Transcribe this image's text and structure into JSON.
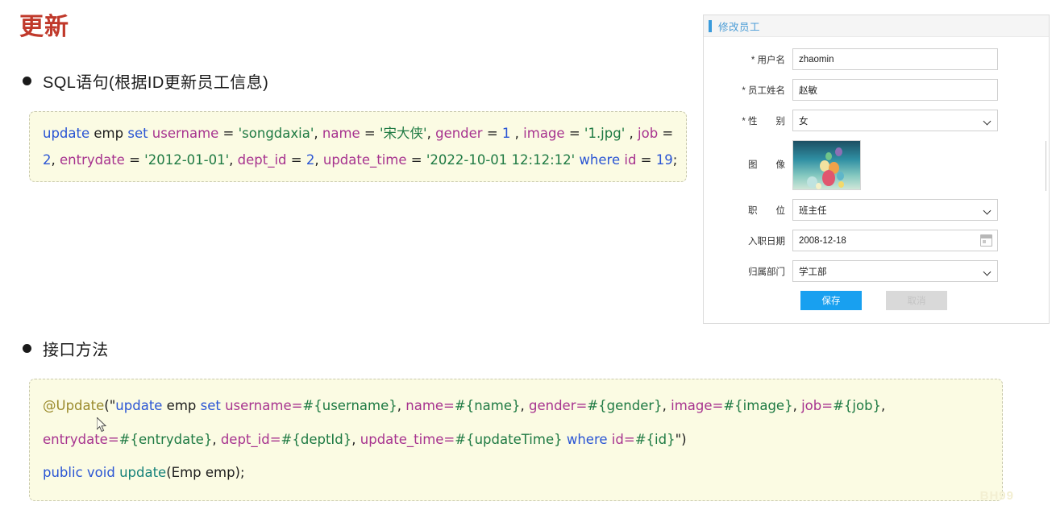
{
  "slide": {
    "title": "更新",
    "bullets": [
      {
        "id": "sql",
        "text": "SQL语句(根据ID更新员工信息)"
      },
      {
        "id": "api",
        "text": "接口方法"
      }
    ],
    "watermark": "BH99"
  },
  "sql_code": {
    "line1": {
      "kw_update": "update",
      "tbl": " emp ",
      "kw_set": "set",
      "col_username": " username",
      "eq1": " = ",
      "str_username": "'songdaxia'",
      "comma1": ", ",
      "col_name": "name",
      "eq2": " = ",
      "str_name": "'宋大侠'",
      "comma2": ", ",
      "col_gender": "gender",
      "eq3": " = ",
      "num_gender": "1",
      "comma3": " , ",
      "col_image": "image",
      "eq4": " = ",
      "str_image": "'1.jpg'",
      "comma4": " , ",
      "col_job": "job",
      "eq5": " ="
    },
    "line2": {
      "num_job": "2",
      "comma1": ", ",
      "col_entrydate": "entrydate",
      "eq1": " = ",
      "str_entrydate": "'2012-01-01'",
      "comma2": ", ",
      "col_deptid": "dept_id",
      "eq2": " = ",
      "num_deptid": "2",
      "comma3": ", ",
      "col_updatetime": "update_time",
      "eq3": " = ",
      "str_updatetime": "'2022-10-01 12:12:12'",
      "sp": " ",
      "kw_where": "where",
      "col_id": " id",
      "eq4": " = ",
      "num_id": "19",
      "semi": ";"
    }
  },
  "api_code": {
    "line1": {
      "annotation": "@Update",
      "open": "(\"",
      "kw_update": "update",
      "tbl": " emp ",
      "kw_set": "set",
      "col_username": " username=",
      "p_username": "#{username}",
      "c1": ", ",
      "col_name": "name=",
      "p_name": "#{name}",
      "c2": ", ",
      "col_gender": "gender=",
      "p_gender": "#{gender}",
      "c3": ", ",
      "col_image": "image=",
      "p_image": "#{image}",
      "c4": ", ",
      "col_job": "job=",
      "p_job": "#{job}",
      "c5": ","
    },
    "line2": {
      "col_entrydate": "entrydate=",
      "p_entrydate": "#{entrydate}",
      "c1": ", ",
      "col_deptid": "dept_id=",
      "p_deptid": "#{deptId}",
      "c2": ", ",
      "col_updatetime": "update_time=",
      "p_updatetime": "#{updateTime}",
      "sp": " ",
      "kw_where": "where",
      "col_id": " id=",
      "p_id": "#{id}",
      "close": "\")"
    },
    "line3": {
      "modifiers": "public void ",
      "method": "update",
      "signature": "(Emp emp);"
    }
  },
  "form": {
    "title": "修改员工",
    "fields": [
      {
        "label": "* 用户名",
        "value": "zhaomin",
        "type": "text"
      },
      {
        "label": "* 员工姓名",
        "value": "赵敏",
        "type": "text"
      },
      {
        "label": "* 性　　别",
        "value": "女",
        "type": "select"
      },
      {
        "label": "图　　像",
        "value": "",
        "type": "image"
      },
      {
        "label": "职　　位",
        "value": "班主任",
        "type": "select"
      },
      {
        "label": "入职日期",
        "value": "2008-12-18",
        "type": "date"
      },
      {
        "label": "归属部门",
        "value": "学工部",
        "type": "select"
      }
    ],
    "buttons": {
      "save": "保存",
      "cancel": "取消"
    },
    "colors": {
      "accent": "#3a9bdc",
      "save_bg": "#18a0f0",
      "cancel_bg": "#d9d9d9"
    }
  }
}
